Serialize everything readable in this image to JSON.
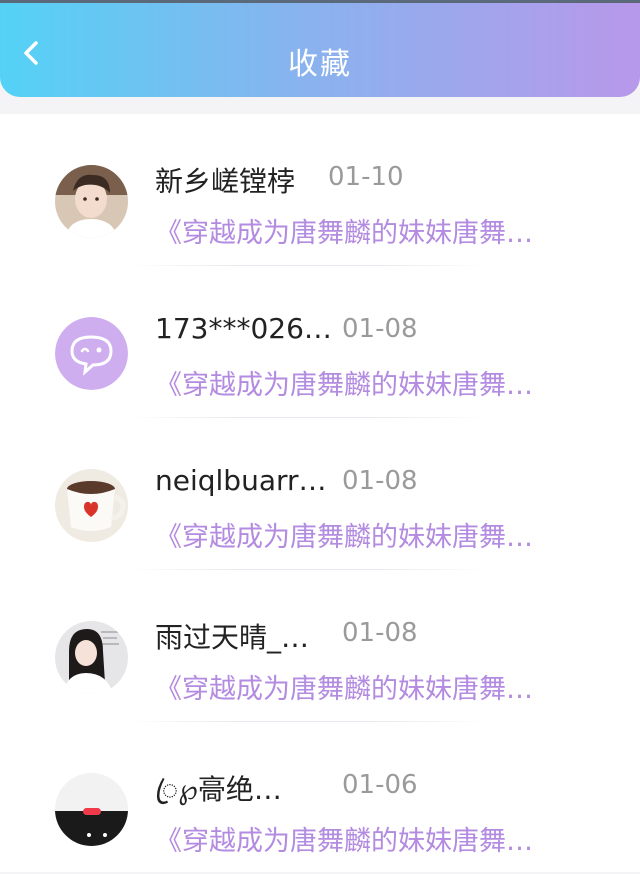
{
  "header": {
    "title": "收藏",
    "back_icon": "chevron-left-icon"
  },
  "favorites": [
    {
      "username": "新乡嵯镗桲",
      "date": "01-10",
      "snippet": "《穿越成为唐舞麟的妹妹唐舞…",
      "avatar": "boy-photo"
    },
    {
      "username": "173***026…",
      "date": "01-08",
      "snippet": "《穿越成为唐舞麟的妹妹唐舞…",
      "avatar": "chat-bubble-icon"
    },
    {
      "username": "neiqlbuarr…",
      "date": "01-08",
      "snippet": "《穿越成为唐舞麟的妹妹唐舞…",
      "avatar": "heart-mug-photo"
    },
    {
      "username": "雨过天晴_…",
      "date": "01-08",
      "snippet": "《穿越成为唐舞麟的妹妹唐舞…",
      "avatar": "girl-photo"
    },
    {
      "username": "ꦿ℘䯧绝…",
      "date": "01-06",
      "snippet": "《穿越成为唐舞麟的妹妹唐舞…",
      "avatar": "phone-screenshot-photo"
    }
  ],
  "colors": {
    "header_gradient_start": "#54d2f6",
    "header_gradient_end": "#b898ea",
    "snippet_color": "#b38be0",
    "date_color": "#9a9a9a"
  }
}
